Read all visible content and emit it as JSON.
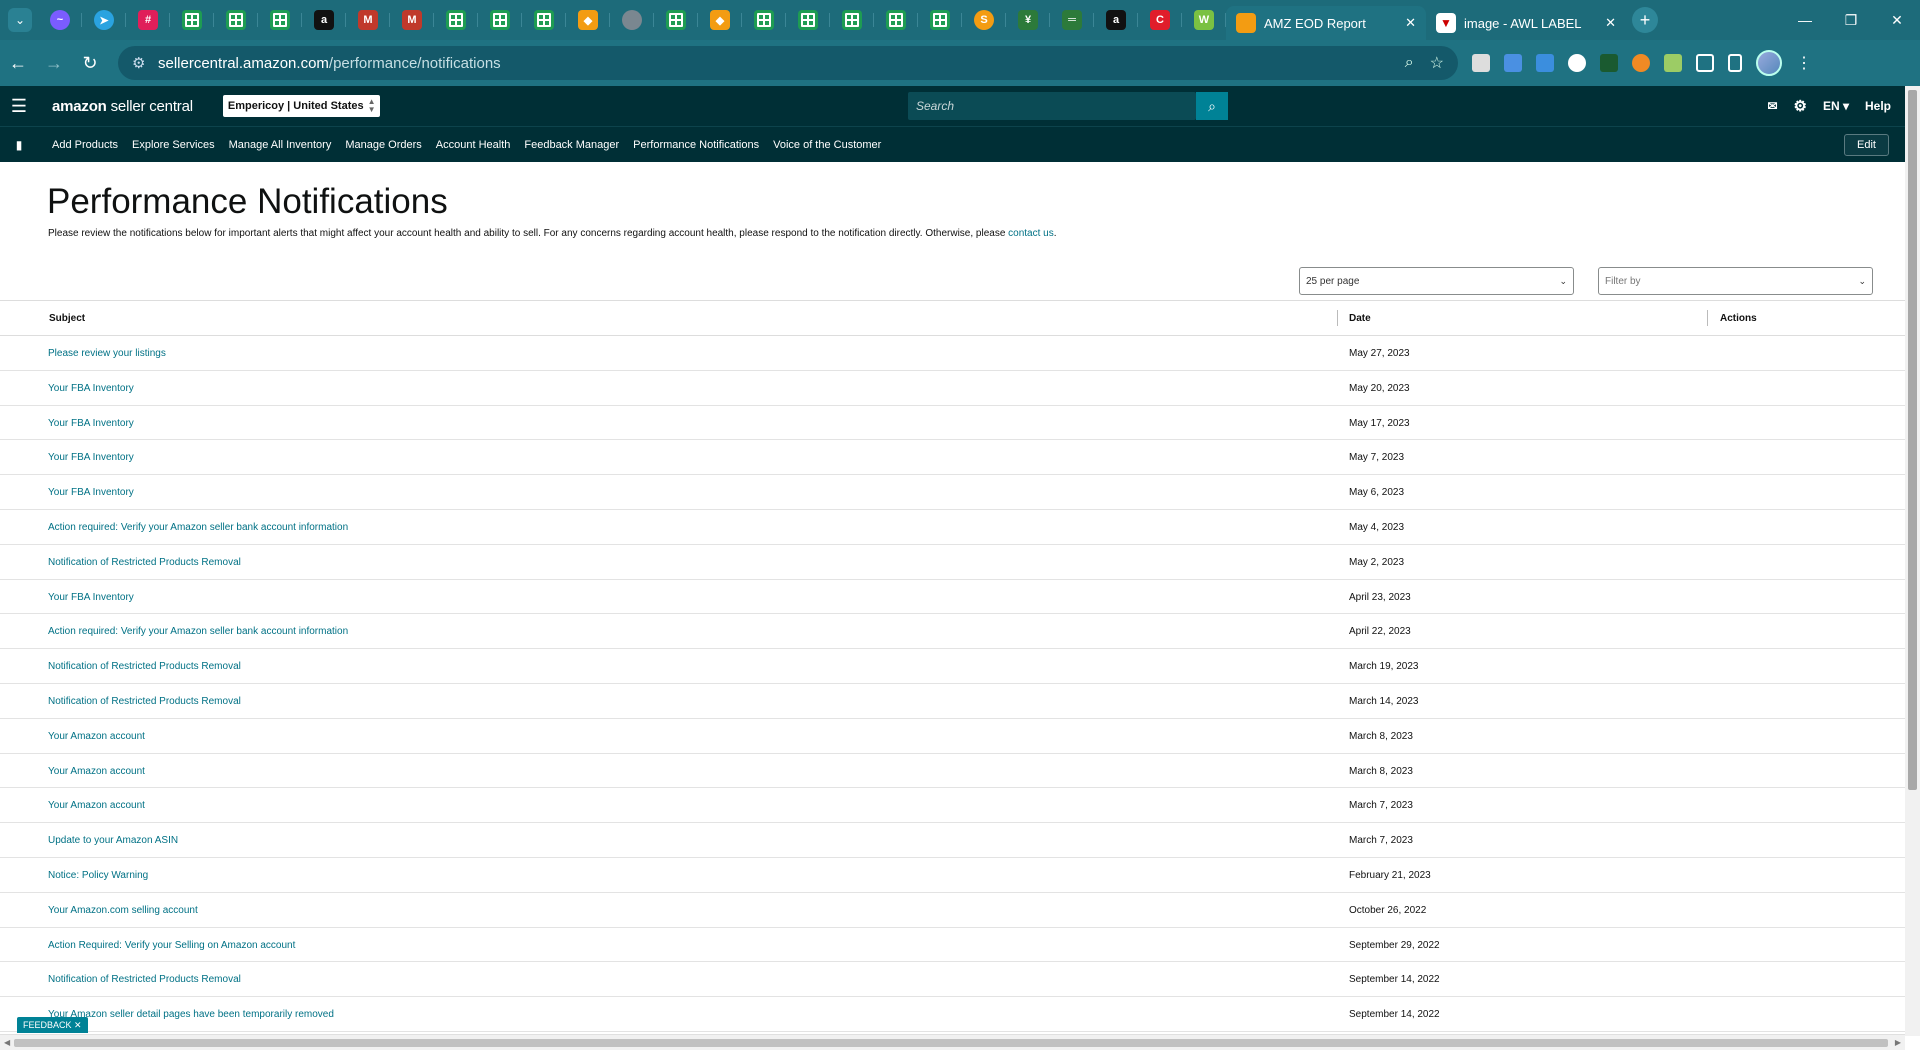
{
  "browser": {
    "tabs": [
      {
        "title": "AMZ EOD Report"
      },
      {
        "title": "image - AWL LABEL"
      }
    ],
    "url_host": "sellercentral.amazon.com",
    "url_path": "/performance/notifications",
    "pinned_icons": [
      "messenger-icon",
      "telegram-icon",
      "slack-icon",
      "sheets-icon",
      "sheets-icon",
      "sheets-icon",
      "amazon-icon",
      "gmail-icon",
      "gmail-icon",
      "sheets-icon",
      "sheets-icon",
      "sheets-icon",
      "jira-icon",
      "globe-icon",
      "sheets-icon",
      "jira-icon",
      "sheets-icon",
      "sheets-icon",
      "sheets-icon",
      "sheets-icon",
      "sheets-icon",
      "orange-icon",
      "wheat-icon",
      "banner-icon",
      "amazon-icon",
      "red-c-icon",
      "w-icon"
    ]
  },
  "header": {
    "logo_a": "amazon",
    "logo_b": "seller central",
    "account": "Empericoy | United States",
    "search_placeholder": "Search",
    "lang": "EN",
    "help": "Help"
  },
  "nav": {
    "items": [
      "Add Products",
      "Explore Services",
      "Manage All Inventory",
      "Manage Orders",
      "Account Health",
      "Feedback Manager",
      "Performance Notifications",
      "Voice of the Customer"
    ],
    "edit": "Edit"
  },
  "page": {
    "title": "Performance Notifications",
    "intro": "Please review the notifications below for important alerts that might affect your account health and ability to sell. For any concerns regarding account health, please respond to the notification directly. Otherwise, please ",
    "intro_link": "contact us",
    "intro_end": ".",
    "per_page": "25 per page",
    "filter_placeholder": "Filter by"
  },
  "table": {
    "columns": {
      "subject": "Subject",
      "date": "Date",
      "actions": "Actions"
    },
    "rows": [
      {
        "subject": "Please review your listings",
        "date": "May 27, 2023"
      },
      {
        "subject": "Your FBA Inventory",
        "date": "May 20, 2023"
      },
      {
        "subject": "Your FBA Inventory",
        "date": "May 17, 2023"
      },
      {
        "subject": "Your FBA Inventory",
        "date": "May 7, 2023"
      },
      {
        "subject": "Your FBA Inventory",
        "date": "May 6, 2023"
      },
      {
        "subject": "Action required: Verify your Amazon seller bank account information",
        "date": "May 4, 2023"
      },
      {
        "subject": "Notification of Restricted Products Removal",
        "date": "May 2, 2023"
      },
      {
        "subject": "Your FBA Inventory",
        "date": "April 23, 2023"
      },
      {
        "subject": "Action required: Verify your Amazon seller bank account information",
        "date": "April 22, 2023"
      },
      {
        "subject": "Notification of Restricted Products Removal",
        "date": "March 19, 2023"
      },
      {
        "subject": "Notification of Restricted Products Removal",
        "date": "March 14, 2023"
      },
      {
        "subject": "Your Amazon account",
        "date": "March 8, 2023"
      },
      {
        "subject": "Your Amazon account",
        "date": "March 8, 2023"
      },
      {
        "subject": "Your Amazon account",
        "date": "March 7, 2023"
      },
      {
        "subject": "Update to your Amazon ASIN",
        "date": "March 7, 2023"
      },
      {
        "subject": "Notice: Policy Warning",
        "date": "February 21, 2023"
      },
      {
        "subject": "Your Amazon.com selling account",
        "date": "October 26, 2022"
      },
      {
        "subject": "Action Required: Verify your Selling on Amazon account",
        "date": "September 29, 2022"
      },
      {
        "subject": "Notification of Restricted Products Removal",
        "date": "September 14, 2022"
      },
      {
        "subject": "Your Amazon seller detail pages have been temporarily removed",
        "date": "September 14, 2022"
      }
    ]
  },
  "feedback": {
    "label": "FEEDBACK"
  },
  "colors": {
    "header_bg": "#002f36",
    "link": "#007185",
    "search_btn": "#008296",
    "browser_chrome": "#1d6b7a"
  }
}
